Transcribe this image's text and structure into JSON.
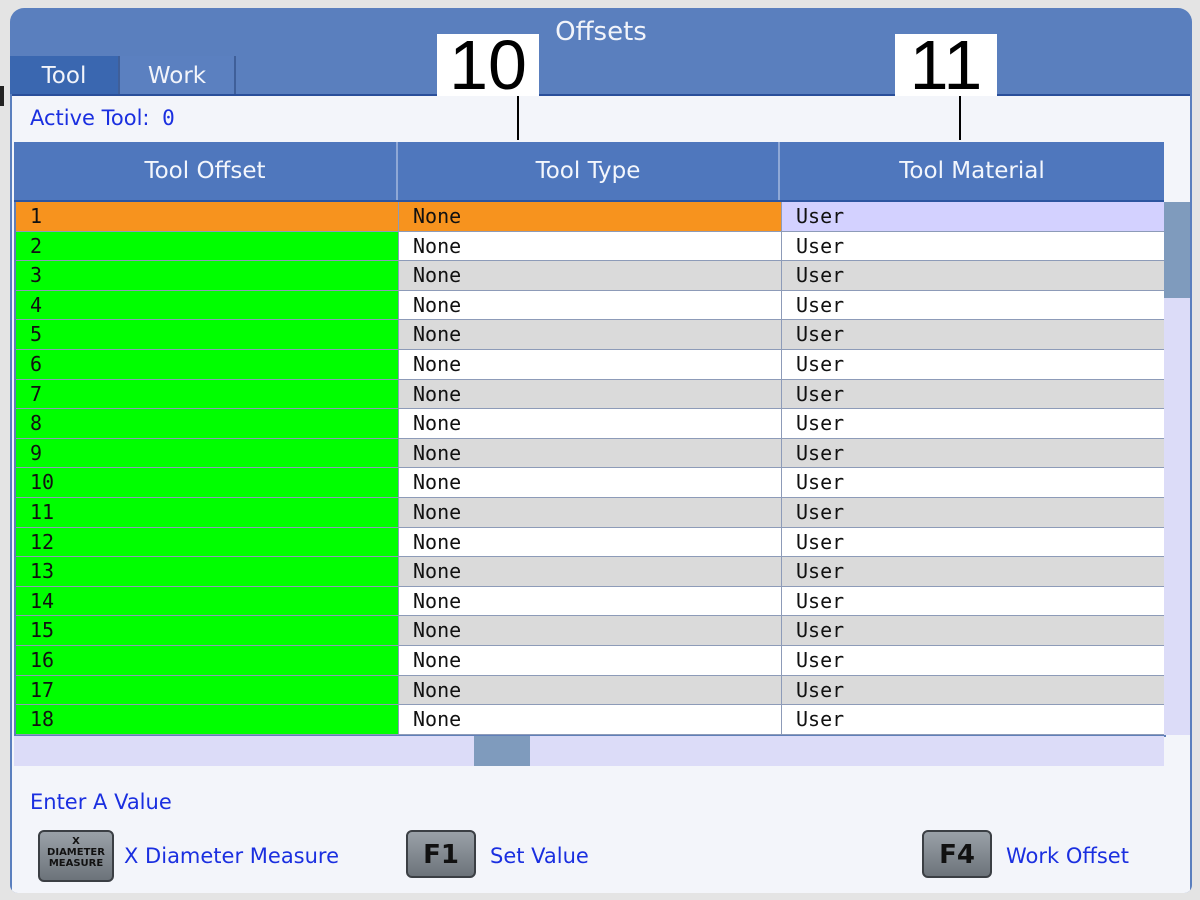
{
  "window": {
    "title": "Offsets"
  },
  "tabs": [
    {
      "label": "Tool",
      "active": true
    },
    {
      "label": "Work",
      "active": false
    }
  ],
  "active_tool": {
    "label": "Active Tool:",
    "value": "0"
  },
  "table": {
    "columns": [
      "Tool Offset",
      "Tool Type",
      "Tool Material"
    ],
    "selected_row": 1,
    "rows": [
      {
        "offset": "1",
        "type": "None",
        "material": "User"
      },
      {
        "offset": "2",
        "type": "None",
        "material": "User"
      },
      {
        "offset": "3",
        "type": "None",
        "material": "User"
      },
      {
        "offset": "4",
        "type": "None",
        "material": "User"
      },
      {
        "offset": "5",
        "type": "None",
        "material": "User"
      },
      {
        "offset": "6",
        "type": "None",
        "material": "User"
      },
      {
        "offset": "7",
        "type": "None",
        "material": "User"
      },
      {
        "offset": "8",
        "type": "None",
        "material": "User"
      },
      {
        "offset": "9",
        "type": "None",
        "material": "User"
      },
      {
        "offset": "10",
        "type": "None",
        "material": "User"
      },
      {
        "offset": "11",
        "type": "None",
        "material": "User"
      },
      {
        "offset": "12",
        "type": "None",
        "material": "User"
      },
      {
        "offset": "13",
        "type": "None",
        "material": "User"
      },
      {
        "offset": "14",
        "type": "None",
        "material": "User"
      },
      {
        "offset": "15",
        "type": "None",
        "material": "User"
      },
      {
        "offset": "16",
        "type": "None",
        "material": "User"
      },
      {
        "offset": "17",
        "type": "None",
        "material": "User"
      },
      {
        "offset": "18",
        "type": "None",
        "material": "User"
      }
    ]
  },
  "prompt": "Enter A Value",
  "keys": {
    "xdm": {
      "cap": [
        "X",
        "DIAMETER",
        "MEASURE"
      ],
      "label": "X Diameter Measure"
    },
    "f1": {
      "cap": "F1",
      "label": "Set Value"
    },
    "f4": {
      "cap": "F4",
      "label": "Work Offset"
    }
  },
  "callouts": {
    "a": "10",
    "b": "11"
  },
  "colors": {
    "title_bar": "#5a7fbe",
    "selected_row": "#f7931e",
    "offset_column": "#00ff00",
    "link_text": "#1a2fe0"
  }
}
